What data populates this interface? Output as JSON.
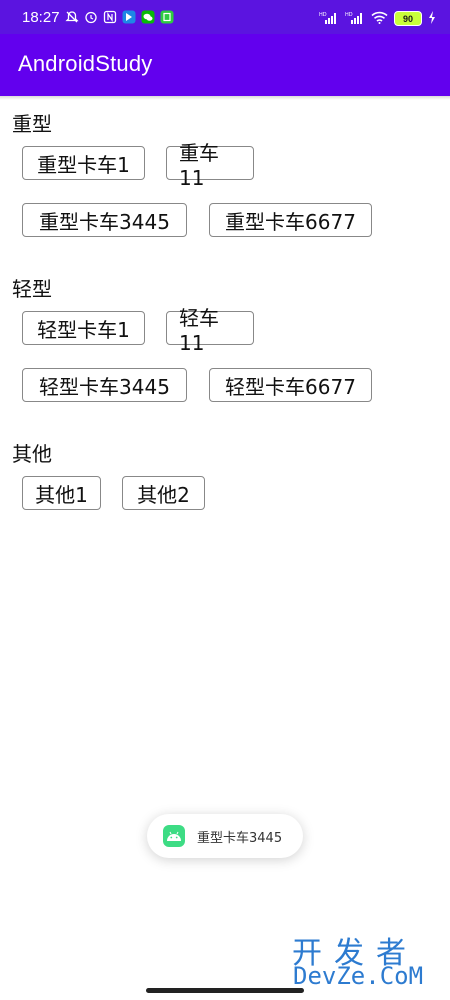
{
  "status_bar": {
    "time": "18:27",
    "battery": "90",
    "icons_left": [
      "mute-icon",
      "alarm-icon",
      "nfc-icon",
      "app-icon",
      "wechat-icon",
      "app-icon"
    ],
    "icons_right": [
      "signal-hd-icon",
      "signal-hd-icon",
      "wifi-icon",
      "battery-icon",
      "charging-icon"
    ]
  },
  "app_bar": {
    "title": "AndroidStudy",
    "color": "#6200ee"
  },
  "sections": [
    {
      "title": "重型",
      "rows": [
        [
          "重型卡车1",
          "重车11"
        ],
        [
          "重型卡车3445",
          "重型卡车6677"
        ]
      ]
    },
    {
      "title": "轻型",
      "rows": [
        [
          "轻型卡车1",
          "轻车11"
        ],
        [
          "轻型卡车3445",
          "轻型卡车6677"
        ]
      ]
    },
    {
      "title": "其他",
      "rows": [
        [
          "其他1",
          "其他2"
        ]
      ]
    }
  ],
  "toast": {
    "text": "重型卡车3445",
    "icon": "android-icon"
  },
  "watermark": {
    "line1": "开发者",
    "line2": "DevZe.CoM"
  }
}
